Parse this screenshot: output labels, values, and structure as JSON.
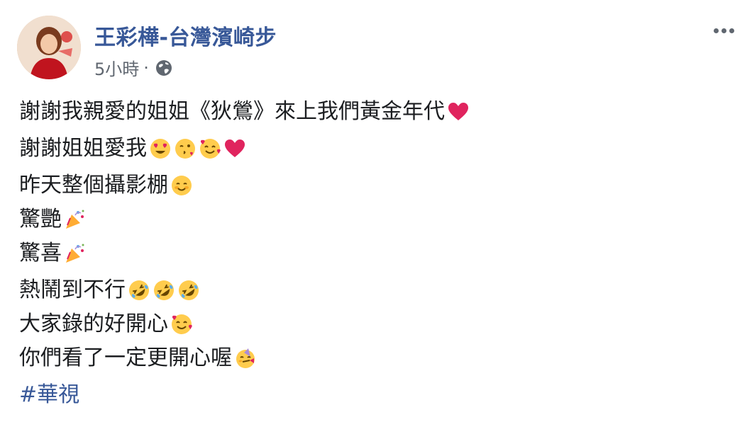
{
  "post": {
    "author": "王彩樺-台灣濱崎步",
    "time": "5小時",
    "separator": "·",
    "privacy_icon": "globe-icon",
    "more_icon": "more-options-icon"
  },
  "paragraphs": [
    [
      {
        "text": "謝謝我親愛的姐姐《狄鶯》來上我們黃金年代",
        "emojis": [
          "red-heart"
        ]
      }
    ],
    [
      {
        "text": "謝謝姐姐愛我",
        "emojis": [
          "heart-eyes",
          "kissing-heart",
          "smiling-hearts",
          "red-heart"
        ]
      }
    ],
    [
      {
        "text": "昨天整個攝影棚",
        "emojis": [
          "smiling-blush"
        ]
      },
      {
        "text": "驚艷",
        "emojis": [
          "party-popper"
        ]
      },
      {
        "text": "驚喜",
        "emojis": [
          "party-popper"
        ]
      }
    ],
    [
      {
        "text": "熱鬧到不行",
        "emojis": [
          "rolling-laughing",
          "rolling-laughing",
          "rolling-laughing"
        ]
      },
      {
        "text": "大家錄的好開心",
        "emojis": [
          "smiling-hearts"
        ]
      },
      {
        "text": "你們看了一定更開心喔",
        "emojis": [
          "partying-face"
        ]
      }
    ]
  ],
  "hashtag": "#華視"
}
